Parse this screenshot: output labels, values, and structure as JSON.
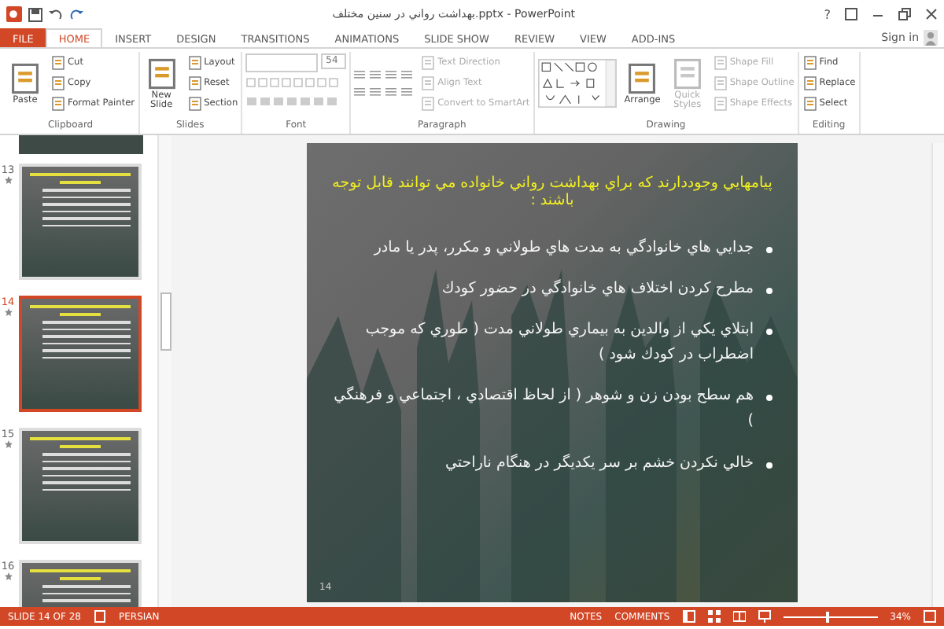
{
  "window": {
    "title": "بهداشت رواني در سنين مختلف.pptx - PowerPoint",
    "help": "?"
  },
  "ribbon": {
    "tabs": [
      {
        "label": "FILE",
        "selected": false,
        "kind": "file"
      },
      {
        "label": "HOME",
        "selected": true,
        "kind": "tab"
      },
      {
        "label": "INSERT",
        "selected": false,
        "kind": "tab"
      },
      {
        "label": "DESIGN",
        "selected": false,
        "kind": "tab"
      },
      {
        "label": "TRANSITIONS",
        "selected": false,
        "kind": "tab"
      },
      {
        "label": "ANIMATIONS",
        "selected": false,
        "kind": "tab"
      },
      {
        "label": "SLIDE SHOW",
        "selected": false,
        "kind": "tab"
      },
      {
        "label": "REVIEW",
        "selected": false,
        "kind": "tab"
      },
      {
        "label": "VIEW",
        "selected": false,
        "kind": "tab"
      },
      {
        "label": "ADD-INS",
        "selected": false,
        "kind": "tab"
      }
    ],
    "sign_in": "Sign in",
    "groups": [
      {
        "label": "Clipboard",
        "items": [
          {
            "kind": "large",
            "label": "Paste",
            "disabled": false
          },
          {
            "kind": "small",
            "label": "Cut",
            "disabled": false
          },
          {
            "kind": "small",
            "label": "Copy",
            "disabled": false
          },
          {
            "kind": "small",
            "label": "Format Painter",
            "disabled": false
          }
        ]
      },
      {
        "label": "Slides",
        "items": [
          {
            "kind": "large",
            "label": "New Slide",
            "disabled": false
          },
          {
            "kind": "small",
            "label": "Layout",
            "disabled": false
          },
          {
            "kind": "small",
            "label": "Reset",
            "disabled": false
          },
          {
            "kind": "small",
            "label": "Section",
            "disabled": false
          }
        ]
      },
      {
        "label": "Font",
        "items": [
          {
            "kind": "field",
            "value": "54"
          },
          {
            "kind": "font_tools"
          }
        ]
      },
      {
        "label": "Paragraph",
        "items": [
          {
            "kind": "paragraph_tools"
          },
          {
            "kind": "small",
            "label": "Text Direction",
            "disabled": true
          },
          {
            "kind": "small",
            "label": "Align Text",
            "disabled": true
          },
          {
            "kind": "small",
            "label": "Convert to SmartArt",
            "disabled": true
          }
        ]
      },
      {
        "label": "Drawing",
        "items": [
          {
            "kind": "gallery"
          },
          {
            "kind": "large",
            "label": "Arrange",
            "disabled": false
          },
          {
            "kind": "large",
            "label": "Quick Styles",
            "disabled": true
          },
          {
            "kind": "small",
            "label": "Shape Fill",
            "disabled": true
          },
          {
            "kind": "small",
            "label": "Shape Outline",
            "disabled": true
          },
          {
            "kind": "small",
            "label": "Shape Effects",
            "disabled": true
          }
        ]
      },
      {
        "label": "Editing",
        "items": [
          {
            "kind": "small",
            "label": "Find",
            "disabled": false
          },
          {
            "kind": "small",
            "label": "Replace",
            "disabled": false
          },
          {
            "kind": "small",
            "label": "Select",
            "disabled": false
          }
        ]
      }
    ]
  },
  "thumbnails": [
    {
      "number": "13",
      "selected": false
    },
    {
      "number": "14",
      "selected": true
    },
    {
      "number": "15",
      "selected": false
    },
    {
      "number": "16",
      "selected": false
    }
  ],
  "slide": {
    "title": "پيامهايي وجوددارند كه براي بهداشت رواني خانواده مي توانند قابل توجه باشند :",
    "bullets": [
      "جدايي هاي خانوادگي به مدت هاي طولاني و مكرر، پدر يا مادر",
      "مطرح كردن اختلاف هاي  خانوادگي در حضور كودك",
      "ابتلاي يكي از والدين به بيماري طولاني مدت ( طوري كه موجب اضطراب در كودك شود )",
      "هم سطح بودن زن و شوهر ( از لحاظ اقتصادي ، اجتماعي و فرهنگي )",
      "خالي نكردن خشم بر سر يكديگر در هنگام ناراحتي"
    ],
    "number": "14"
  },
  "status_bar": {
    "slide_info": "SLIDE 14 OF 28",
    "language": "PERSIAN",
    "notes": "NOTES",
    "comments": "COMMENTS",
    "zoom": {
      "level": 0.45,
      "reading": "34%"
    }
  }
}
